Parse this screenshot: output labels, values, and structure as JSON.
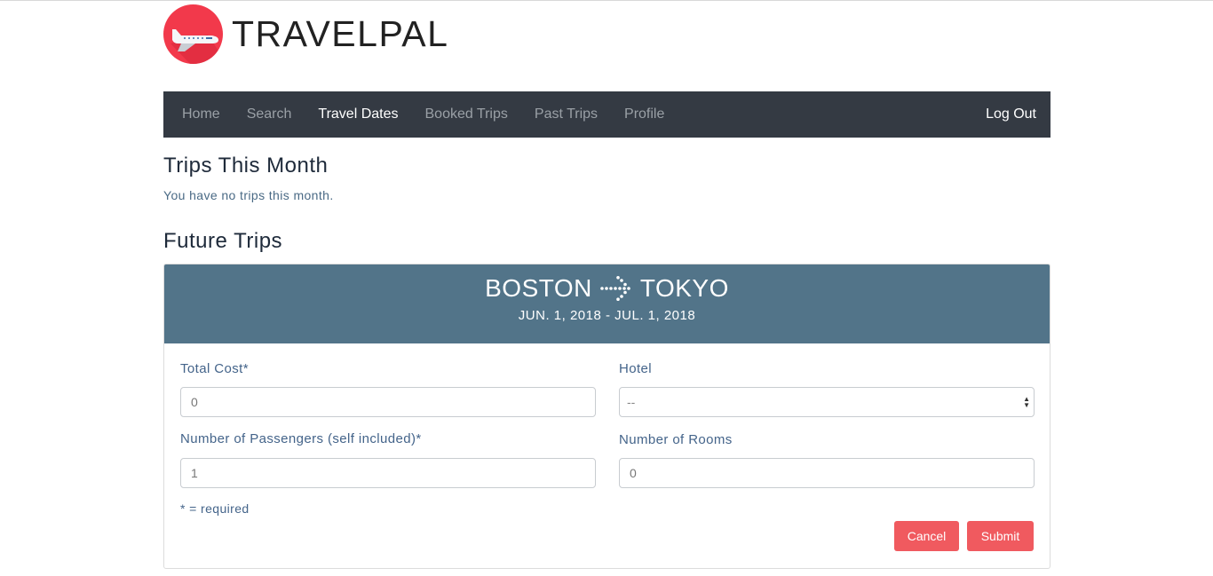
{
  "brand": {
    "name": "TRAVELPAL",
    "logo_icon": "airplane-icon",
    "logo_color": "#f2394b"
  },
  "nav": {
    "items": [
      {
        "label": "Home",
        "active": false
      },
      {
        "label": "Search",
        "active": false
      },
      {
        "label": "Travel Dates",
        "active": true
      },
      {
        "label": "Booked Trips",
        "active": false
      },
      {
        "label": "Past Trips",
        "active": false
      },
      {
        "label": "Profile",
        "active": false
      }
    ],
    "logout_label": "Log Out",
    "background": "#343a43"
  },
  "this_month": {
    "title": "Trips This Month",
    "empty_message": "You have no trips this month."
  },
  "future": {
    "title": "Future Trips",
    "trip": {
      "origin": "BOSTON",
      "destination": "TOKYO",
      "arrow_icon": "dotted-arrow-right-icon",
      "dates": "JUN. 1, 2018 - JUL. 1, 2018",
      "header_color": "#527489"
    },
    "form": {
      "total_cost": {
        "label": "Total Cost*",
        "value": "0"
      },
      "hotel": {
        "label": "Hotel",
        "selected": "--"
      },
      "passengers": {
        "label": "Number of Passengers (self included)*",
        "value": "1"
      },
      "rooms": {
        "label": "Number of Rooms",
        "value": "0"
      },
      "required_note": "* = required",
      "cancel_label": "Cancel",
      "submit_label": "Submit",
      "button_color": "#f05a5f"
    }
  }
}
